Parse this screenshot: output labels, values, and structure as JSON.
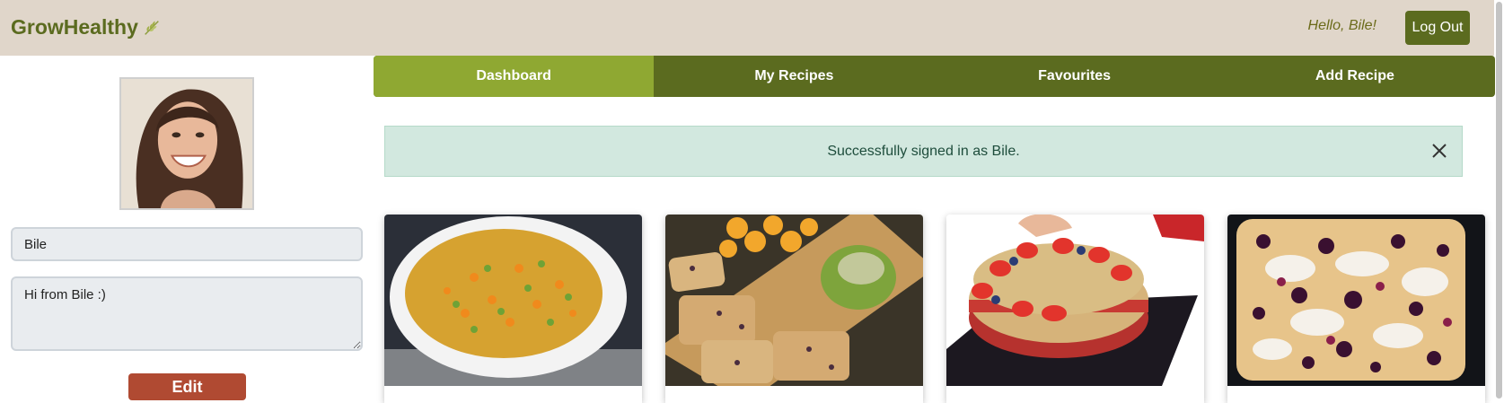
{
  "app": {
    "brand": "GrowHealthy",
    "greeting": "Hello, Bile!",
    "logout_label": "Log Out"
  },
  "profile": {
    "name": "Bile",
    "bio": "Hi from Bile :)",
    "edit_label": "Edit"
  },
  "nav": {
    "tabs": [
      {
        "label": "Dashboard",
        "active": true
      },
      {
        "label": "My Recipes",
        "active": false
      },
      {
        "label": "Favourites",
        "active": false
      },
      {
        "label": "Add Recipe",
        "active": false
      }
    ]
  },
  "alert": {
    "message": "Successfully signed in as Bile."
  },
  "recipes": [
    {
      "image": "soup-bowl-photo"
    },
    {
      "image": "oat-bars-platter-photo"
    },
    {
      "image": "strawberry-cake-photo"
    },
    {
      "image": "berry-tray-bake-photo"
    }
  ],
  "colors": {
    "brand": "#5b6b1f",
    "nav_active": "#8fa832",
    "edit": "#b04a32",
    "header_bg": "#e0d6ca",
    "alert_bg": "#d2e8df"
  }
}
